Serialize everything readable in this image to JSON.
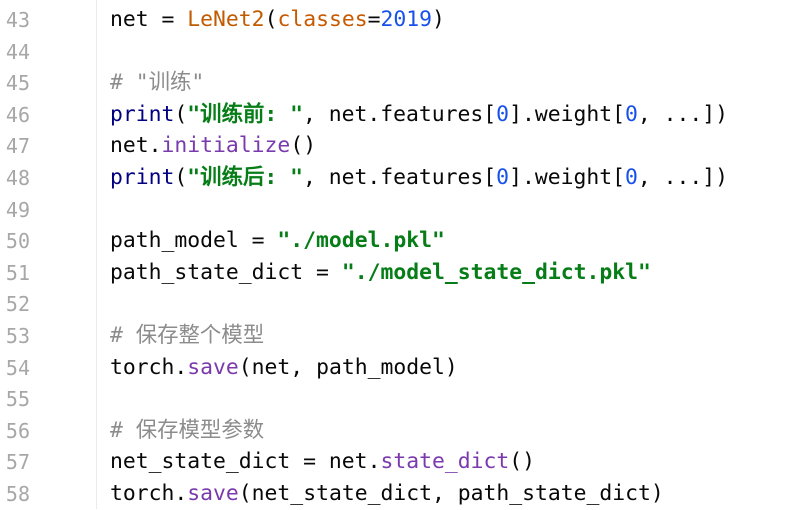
{
  "editor": {
    "colors": {
      "background": "#ffffff",
      "line_number": "#a7a7a7",
      "default_text": "#080808",
      "string": "#067d17",
      "number": "#1750eb",
      "builtin": "#000080",
      "method": "#7a3aad",
      "class_name": "#c15a00",
      "comment": "#8c8c8c"
    },
    "lines": [
      {
        "number": "43",
        "tokens": [
          {
            "text": "net = ",
            "type": "default"
          },
          {
            "text": "LeNet2",
            "type": "class"
          },
          {
            "text": "(",
            "type": "default"
          },
          {
            "text": "classes",
            "type": "kw"
          },
          {
            "text": "=",
            "type": "default"
          },
          {
            "text": "2019",
            "type": "num"
          },
          {
            "text": ")",
            "type": "default"
          }
        ]
      },
      {
        "number": "44",
        "tokens": []
      },
      {
        "number": "45",
        "tokens": [
          {
            "text": "# \"训练\"",
            "type": "comment"
          }
        ]
      },
      {
        "number": "46",
        "tokens": [
          {
            "text": "print",
            "type": "builtin"
          },
          {
            "text": "(",
            "type": "default"
          },
          {
            "text": "\"训练前: \"",
            "type": "str"
          },
          {
            "text": ", net.features[",
            "type": "default"
          },
          {
            "text": "0",
            "type": "num"
          },
          {
            "text": "].weight[",
            "type": "default"
          },
          {
            "text": "0",
            "type": "num"
          },
          {
            "text": ", ...])",
            "type": "default"
          }
        ]
      },
      {
        "number": "47",
        "tokens": [
          {
            "text": "net.",
            "type": "default"
          },
          {
            "text": "initialize",
            "type": "method"
          },
          {
            "text": "()",
            "type": "default"
          }
        ]
      },
      {
        "number": "48",
        "tokens": [
          {
            "text": "print",
            "type": "builtin"
          },
          {
            "text": "(",
            "type": "default"
          },
          {
            "text": "\"训练后: \"",
            "type": "str"
          },
          {
            "text": ", net.features[",
            "type": "default"
          },
          {
            "text": "0",
            "type": "num"
          },
          {
            "text": "].weight[",
            "type": "default"
          },
          {
            "text": "0",
            "type": "num"
          },
          {
            "text": ", ...])",
            "type": "default"
          }
        ]
      },
      {
        "number": "49",
        "tokens": []
      },
      {
        "number": "50",
        "tokens": [
          {
            "text": "path_model = ",
            "type": "default"
          },
          {
            "text": "\"./model.pkl\"",
            "type": "str"
          }
        ]
      },
      {
        "number": "51",
        "tokens": [
          {
            "text": "path_state_dict = ",
            "type": "default"
          },
          {
            "text": "\"./model_state_dict.pkl\"",
            "type": "str"
          }
        ]
      },
      {
        "number": "52",
        "tokens": []
      },
      {
        "number": "53",
        "tokens": [
          {
            "text": "# 保存整个模型",
            "type": "comment"
          }
        ]
      },
      {
        "number": "54",
        "tokens": [
          {
            "text": "torch.",
            "type": "default"
          },
          {
            "text": "save",
            "type": "method"
          },
          {
            "text": "(net, path_model)",
            "type": "default"
          }
        ]
      },
      {
        "number": "55",
        "tokens": []
      },
      {
        "number": "56",
        "tokens": [
          {
            "text": "# 保存模型参数",
            "type": "comment"
          }
        ]
      },
      {
        "number": "57",
        "tokens": [
          {
            "text": "net_state_dict = net.",
            "type": "default"
          },
          {
            "text": "state_dict",
            "type": "method"
          },
          {
            "text": "()",
            "type": "default"
          }
        ]
      },
      {
        "number": "58",
        "tokens": [
          {
            "text": "torch.",
            "type": "default"
          },
          {
            "text": "save",
            "type": "method"
          },
          {
            "text": "(net_state_dict, path_state_dict)",
            "type": "default"
          }
        ]
      }
    ]
  }
}
